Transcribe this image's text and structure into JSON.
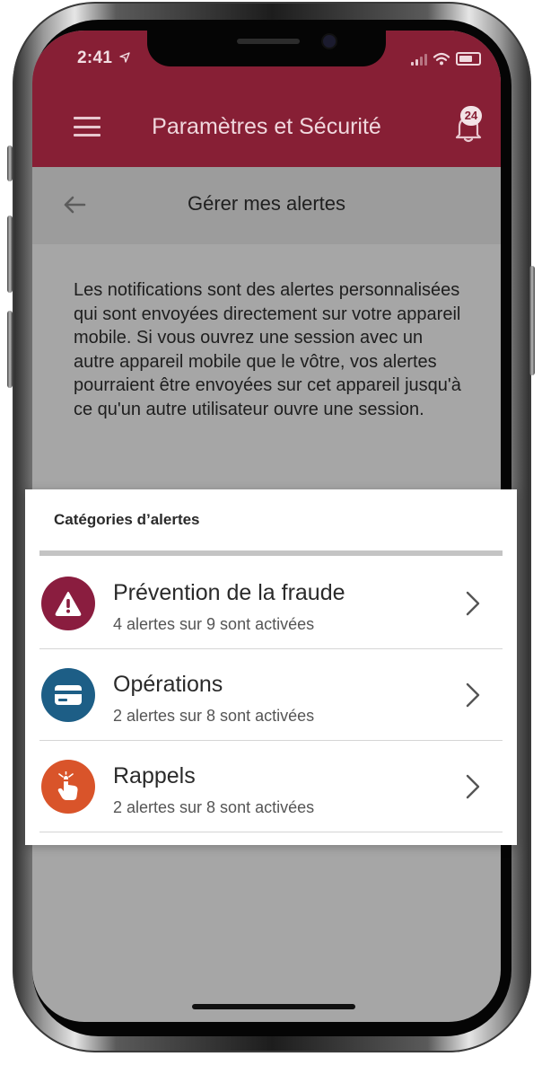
{
  "status": {
    "time": "2:41"
  },
  "header": {
    "title": "Paramètres et Sécurité",
    "notification_count": "24"
  },
  "subheader": {
    "title": "Gérer mes alertes"
  },
  "intro": {
    "text": "Les notifications sont des alertes personnalisées qui sont envoyées directement sur votre appareil mobile. Si vous ouvrez une session avec un autre appareil mobile que le vôtre, vos alertes pourraient être envoyées sur cet appareil jusqu'à ce qu'un autre utilisateur ouvre une session."
  },
  "categories": {
    "title": "Catégories d’alertes",
    "items": [
      {
        "label": "Prévention de la fraude",
        "status": "4 alertes sur 9 sont activées",
        "icon": "warning-icon",
        "color": "#8a1d3f"
      },
      {
        "label": "Opérations",
        "status": "2 alertes sur 8 sont activées",
        "icon": "card-icon",
        "color": "#1d5e86"
      },
      {
        "label": "Rappels",
        "status": "2 alertes sur 8 sont activées",
        "icon": "reminder-hand-icon",
        "color": "#d9542a"
      }
    ]
  },
  "colors": {
    "header": "#871f35",
    "overlay": "#a6a6a6"
  }
}
